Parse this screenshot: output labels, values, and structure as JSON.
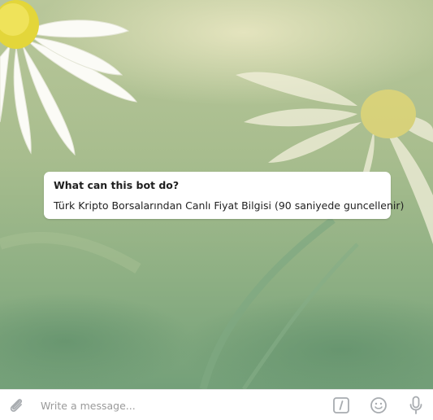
{
  "bot_info": {
    "title": "What can this bot do?",
    "description": "Türk Kripto Borsalarından Canlı Fiyat Bilgisi (90 saniyede guncellenir)"
  },
  "composer": {
    "placeholder": "Write a message...",
    "icons": {
      "attach": "paperclip-icon",
      "commands": "bot-commands-icon",
      "emoji": "smile-icon",
      "voice": "microphone-icon"
    },
    "icon_color": "#a8acb0"
  },
  "background": {
    "image": "chamomile-flowers-wallpaper",
    "colors": [
      "#b9c79a",
      "#8fb084",
      "#74a079"
    ]
  }
}
